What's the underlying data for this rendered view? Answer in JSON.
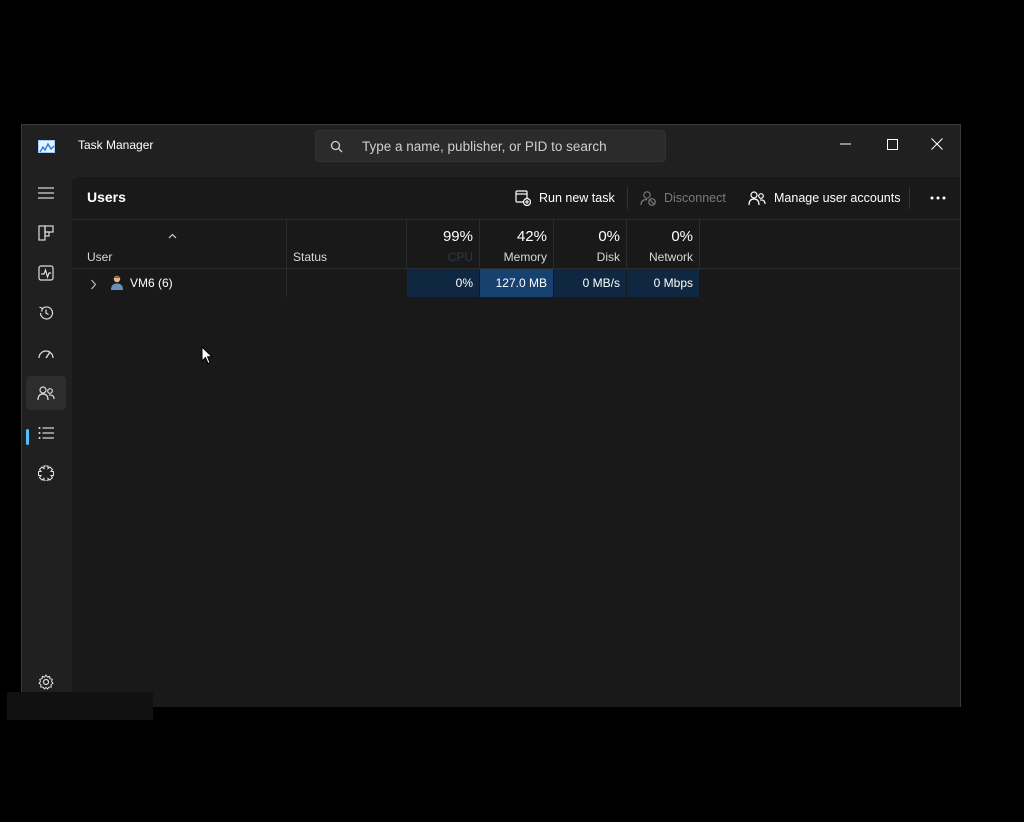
{
  "app": {
    "title": "Task Manager"
  },
  "search": {
    "placeholder": "Type a name, publisher, or PID to search"
  },
  "page": {
    "title": "Users"
  },
  "toolbar": {
    "run_new_task": "Run new task",
    "disconnect": "Disconnect",
    "manage_user_accounts": "Manage user accounts"
  },
  "columns": {
    "user": "User",
    "status": "Status",
    "cpu": {
      "pct": "99%",
      "label": "CPU"
    },
    "memory": {
      "pct": "42%",
      "label": "Memory"
    },
    "disk": {
      "pct": "0%",
      "label": "Disk"
    },
    "network": {
      "pct": "0%",
      "label": "Network"
    }
  },
  "rows": [
    {
      "user": "VM6 (6)",
      "status": "",
      "cpu": "0%",
      "memory": "127.0 MB",
      "disk": "0 MB/s",
      "network": "0 Mbps"
    }
  ],
  "colors": {
    "accent": "#4cc2ff",
    "memory_heat": "#174270",
    "low_heat": "#0f2740"
  },
  "icons": {
    "sidebar": [
      "hamburger-icon",
      "processes-icon",
      "performance-icon",
      "app-history-icon",
      "startup-apps-icon",
      "users-icon",
      "details-icon",
      "services-icon",
      "settings-icon"
    ]
  }
}
